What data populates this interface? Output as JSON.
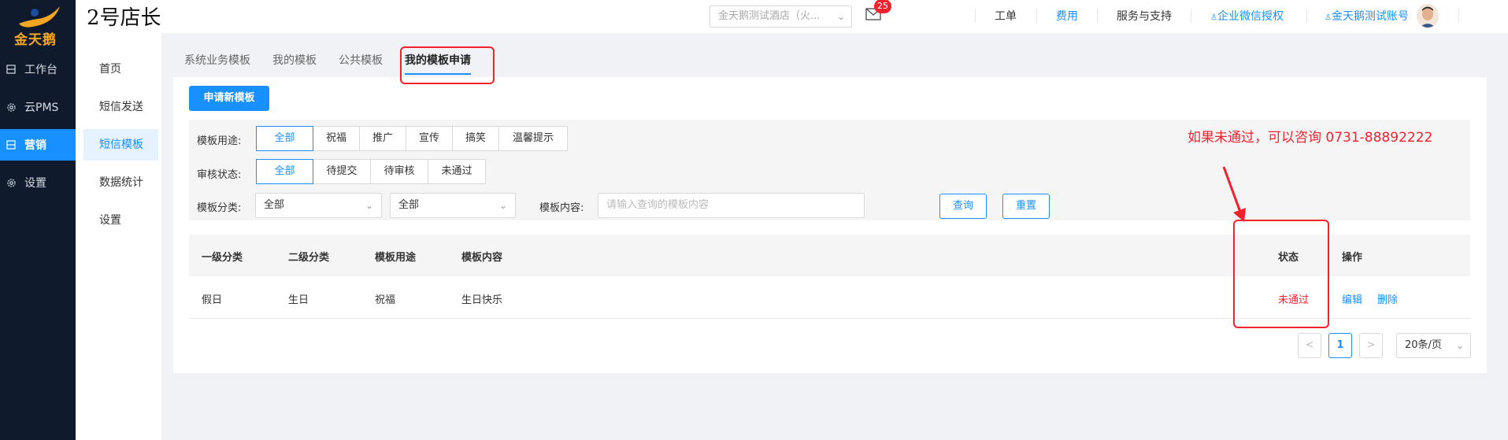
{
  "logo": {
    "text": "金天鹅"
  },
  "sidebar": {
    "items": [
      {
        "label": "工作台",
        "icon": "workbench-icon"
      },
      {
        "label": "云PMS",
        "icon": "gear-icon"
      },
      {
        "label": "营销",
        "icon": "marketing-icon",
        "active": true
      },
      {
        "label": "设置",
        "icon": "gear-icon"
      }
    ]
  },
  "header": {
    "shop_title": "2号店长",
    "hotel_select": "金天鹅测试酒店（火...",
    "mail_badge": "25",
    "links": [
      "工单",
      "费用",
      "服务与支持",
      "企业微信授权",
      "金天鹅测试账号"
    ]
  },
  "submenu": {
    "items": [
      "首页",
      "短信发送",
      "短信模板",
      "数据统计",
      "设置"
    ],
    "active_index": 2
  },
  "tabs": [
    "系统业务模板",
    "我的模板",
    "公共模板",
    "我的模板申请"
  ],
  "new_template_button": "申请新模板",
  "filters": {
    "usage": {
      "label": "模板用途:",
      "options": [
        "全部",
        "祝福",
        "推广",
        "宣传",
        "搞笑",
        "温馨提示"
      ],
      "selected": "全部"
    },
    "status": {
      "label": "审核状态:",
      "options": [
        "全部",
        "待提交",
        "待审核",
        "未通过"
      ],
      "selected": "全部"
    },
    "category": {
      "label": "模板分类:",
      "level1": "全部",
      "level2": "全部"
    },
    "content": {
      "label": "模板内容:",
      "placeholder": "请输入查询的模板内容"
    },
    "query_button": "查询",
    "reset_button": "重置"
  },
  "table": {
    "columns": [
      "一级分类",
      "二级分类",
      "模板用途",
      "模板内容",
      "状态",
      "操作"
    ],
    "rows": [
      {
        "level1": "假日",
        "level2": "生日",
        "usage": "祝福",
        "content": "生日快乐",
        "status": "未通过",
        "actions": [
          "编辑",
          "删除"
        ]
      }
    ]
  },
  "pagination": {
    "prev": "<",
    "current": "1",
    "next": ">",
    "page_size": "20条/页"
  },
  "annotation": {
    "text": "如果未通过，可以咨询 0731-88892222",
    "color": "#f5222d"
  },
  "colors": {
    "primary": "#1890ff",
    "sidebar_bg": "#0f1b2d",
    "danger": "#f5222d"
  }
}
